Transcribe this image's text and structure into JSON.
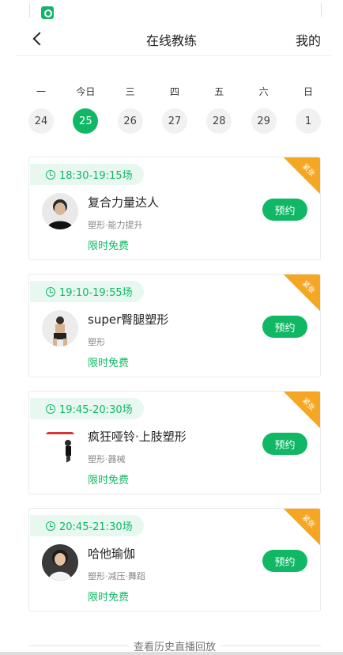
{
  "nav": {
    "title": "在线教练",
    "right_label": "我的"
  },
  "week": [
    {
      "label": "一",
      "num": "24",
      "active": false
    },
    {
      "label": "今日",
      "num": "25",
      "active": true
    },
    {
      "label": "三",
      "num": "26",
      "active": false
    },
    {
      "label": "四",
      "num": "27",
      "active": false
    },
    {
      "label": "五",
      "num": "28",
      "active": false
    },
    {
      "label": "六",
      "num": "29",
      "active": false
    },
    {
      "label": "日",
      "num": "1",
      "active": false
    }
  ],
  "courses": [
    {
      "time": "18:30-19:15场",
      "ribbon": "紧张",
      "title": "复合力量达人",
      "tags": "塑形·能力提升",
      "price": "限时免费",
      "button": "预约"
    },
    {
      "time": "19:10-19:55场",
      "ribbon": "紧张",
      "title": "super臀腿塑形",
      "tags": "塑形",
      "price": "限时免费",
      "button": "预约"
    },
    {
      "time": "19:45-20:30场",
      "ribbon": "紧张",
      "title": "疯狂哑铃·上肢塑形",
      "tags": "塑形·器械",
      "price": "限时免费",
      "button": "预约"
    },
    {
      "time": "20:45-21:30场",
      "ribbon": "紧张",
      "title": "哈他瑜伽",
      "tags": "塑形·减压·舞蹈",
      "price": "限时免费",
      "button": "预约"
    }
  ],
  "footer": {
    "history_label": "查看历史直播回放"
  },
  "colors": {
    "accent": "#10b866",
    "ribbon": "#f5a623"
  }
}
